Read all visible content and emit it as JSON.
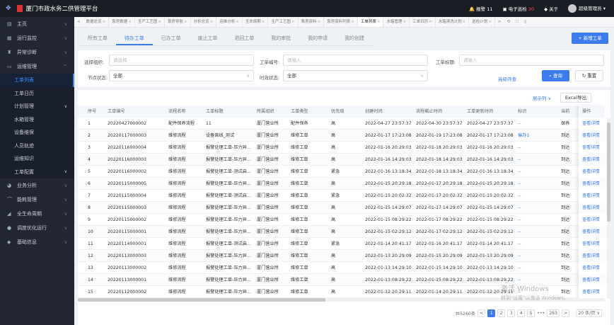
{
  "app": {
    "title": "厦门市政水务二供管理平台",
    "alarm": "报警",
    "alarm_count": "11",
    "inspection": "电子巡检",
    "inspection_count": "30",
    "about": "关于",
    "user": "超级管理员"
  },
  "sidebar": {
    "items": [
      {
        "label": "主页",
        "icon": "home-icon"
      },
      {
        "label": "运行监控",
        "icon": "monitor-icon"
      },
      {
        "label": "异常诊断",
        "icon": "diagnosis-icon"
      },
      {
        "label": "运维管理",
        "icon": "maintenance-icon",
        "expanded": true
      }
    ],
    "sub": [
      "工单列表",
      "工单日历",
      "计划管理",
      "水箱管理",
      "设备维保",
      "人员轨迹",
      "运维知识",
      "工单配置"
    ],
    "sub_active": "工单列表",
    "items2": [
      {
        "label": "业务分析",
        "icon": "analysis-icon"
      },
      {
        "label": "能耗管理",
        "icon": "energy-icon"
      },
      {
        "label": "全生命周期",
        "icon": "lifecycle-icon"
      },
      {
        "label": "调度优化运行",
        "icon": "dispatch-icon"
      },
      {
        "label": "基础信息",
        "icon": "info-icon"
      }
    ]
  },
  "tabbar": [
    "数据总览",
    "泵房数据",
    "生产工艺图",
    "泵房导航",
    "分析总览",
    "运维分析",
    "生命周期",
    "生产工艺图",
    "泵房资料",
    "泵房资料列表",
    "工单列表",
    "水箱管理",
    "工单日历",
    "水箱清洗计划",
    "巡检计划"
  ],
  "tabbar_active": "工单列表",
  "work_tabs": [
    "所有工单",
    "待办工单",
    "已办工单",
    "废止工单",
    "退回工单",
    "我的审批",
    "我的申请",
    "我的创建"
  ],
  "work_tab_active": "待办工单",
  "new_button": "新增工单",
  "filters": {
    "org_label": "选择组织:",
    "org_placeholder": "请选择",
    "no_label": "工单编号:",
    "no_placeholder": "请输入",
    "title_label": "工单标题:",
    "title_placeholder": "请输入",
    "node_label": "节点状态:",
    "node_value": "全部",
    "time_label": "时效状态:",
    "time_value": "全部",
    "advanced": "高级筛查",
    "query": "查询",
    "reset": "重置"
  },
  "table": {
    "show_columns": "展示列",
    "export": "Excel导出",
    "headers": [
      "序号",
      "工单编号",
      "流程名称",
      "工单标题",
      "所属组织",
      "工单类型",
      "优先级",
      "创建时间",
      "流程截止时间",
      "工单更新时间",
      "标识",
      "当前",
      "操作"
    ],
    "rows": [
      [
        "1",
        "20220427000002",
        "配件保养流程",
        "11",
        "厦门营业所",
        "配件保养",
        "高",
        "2022-04-27 23:57:37",
        "2022-04-30 23:57:37",
        "2022-04-27 23:57:37",
        "--",
        "保养",
        "查看详情"
      ],
      [
        "2",
        "20220117000003",
        "维修流程",
        "设备离线_测试",
        "厦门营业所",
        "维修工单",
        "高",
        "2022-01-17 17:23:08",
        "2022-01-19 17:23:08",
        "2022-01-17 17:23:08",
        "催办1",
        "到达",
        "查看详情"
      ],
      [
        "3",
        "20220116000004",
        "维修流程",
        "报警处理工单-压力异...",
        "厦门营业所",
        "维修工单",
        "高",
        "2022-01-16 20:29:03",
        "2022-01-18 20:29:03",
        "2022-01-16 20:29:03",
        "--",
        "到达",
        "查看详情"
      ],
      [
        "4",
        "20220116000003",
        "维修流程",
        "报警处理工单-压力异...",
        "厦门营业所",
        "维修工单",
        "高",
        "2022-01-16 14:29:03",
        "2022-01-18 14:29:03",
        "2022-01-16 14:29:03",
        "--",
        "到达",
        "查看详情"
      ],
      [
        "5",
        "20220116000002",
        "维修流程",
        "报警处理工单-测试启...",
        "厦门营业所",
        "维修工单",
        "紧急",
        "2022-01-16 13:18:34",
        "2022-01-18 13:18:34",
        "2022-01-16 13:18:34",
        "--",
        "到达",
        "查看详情"
      ],
      [
        "6",
        "20220115000005",
        "维修流程",
        "报警处理工单-压力异...",
        "厦门营业所",
        "维修工单",
        "高",
        "2022-01-15 20:29:18",
        "2022-01-17 20:29:18",
        "2022-01-15 20:29:18",
        "--",
        "到达",
        "查看详情"
      ],
      [
        "7",
        "20220115000004",
        "维修流程",
        "报警处理工单-测试启...",
        "厦门营业所",
        "维修工单",
        "紧急",
        "2022-01-15 20:02:32",
        "2022-01-17 20:02:32",
        "2022-01-15 20:02:32",
        "--",
        "到达",
        "查看详情"
      ],
      [
        "8",
        "20220115000003",
        "维修流程",
        "报警处理工单-压力异...",
        "厦门营业所",
        "维修工单",
        "高",
        "2022-01-15 14:29:07",
        "2022-01-17 14:29:07",
        "2022-01-15 14:29:07",
        "--",
        "到达",
        "查看详情"
      ],
      [
        "9",
        "20220115000002",
        "维修流程",
        "报警处理工单-压力异...",
        "厦门营业所",
        "维修工单",
        "高",
        "2022-01-15 08:29:22",
        "2022-01-17 08:29:22",
        "2022-01-15 08:29:22",
        "--",
        "到达",
        "查看详情"
      ],
      [
        "10",
        "20220115000001",
        "维修流程",
        "报警处理工单-压力异...",
        "厦门营业所",
        "维修工单",
        "高",
        "2022-01-15 02:29:12",
        "2022-01-17 02:29:12",
        "2022-01-15 02:29:12",
        "--",
        "到达",
        "查看详情"
      ],
      [
        "11",
        "20220114000001",
        "维修流程",
        "报警处理工单-测试启...",
        "厦门营业所",
        "维修工单",
        "紧急",
        "2022-01-14 20:41:17",
        "2022-01-16 20:41:17",
        "2022-01-14 20:41:17",
        "--",
        "到达",
        "查看详情"
      ],
      [
        "12",
        "20220113000003",
        "维修流程",
        "报警处理工单-压力异...",
        "厦门营业所",
        "维修工单",
        "高",
        "2022-01-13 20:29:09",
        "2022-01-15 20:29:09",
        "2022-01-13 20:29:09",
        "--",
        "到达",
        "查看详情"
      ],
      [
        "13",
        "20220113000002",
        "维修流程",
        "报警处理工单-压力异...",
        "厦门营业所",
        "维修工单",
        "高",
        "2022-01-13 14:29:10",
        "2022-01-15 14:29:10",
        "2022-01-13 14:29:10",
        "--",
        "到达",
        "查看详情"
      ],
      [
        "14",
        "20220113000001",
        "维修流程",
        "报警处理工单-压力异...",
        "厦门营业所",
        "维修工单",
        "高",
        "2022-01-13 08:29:22",
        "2022-01-15 08:29:22",
        "2022-01-13 08:29:22",
        "--",
        "到达",
        "查看详情"
      ],
      [
        "15",
        "20220112000002",
        "维修流程",
        "报警处理工单-压力异...",
        "厦门营业所",
        "维修工单",
        "高",
        "2022-01-12 20:29:11",
        "2022-01-14 20:29:11",
        "2022-01-12 20:29:11",
        "--",
        "到达",
        "查看详情"
      ]
    ]
  },
  "pagination": {
    "total": "共5260条",
    "pages": [
      "1",
      "2",
      "3",
      "4",
      "5",
      "•••",
      "263"
    ],
    "current": "1",
    "page_size": "20 条/页"
  },
  "watermark": {
    "line1": "激活 Windows",
    "line2": "转到\"设置\"以激活 Windows。"
  },
  "colors": {
    "accent": "#3d7cf0",
    "sidebar": "#222733",
    "topbar": "#1a1d24"
  }
}
